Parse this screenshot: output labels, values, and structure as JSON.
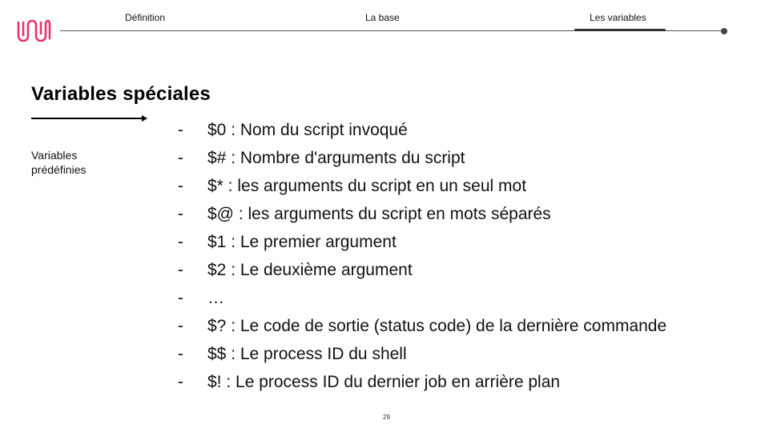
{
  "brand": {
    "logo_color": "#e8336d"
  },
  "nav": {
    "items": [
      {
        "label": "Définition",
        "active": false
      },
      {
        "label": "La base",
        "active": false
      },
      {
        "label": "Les variables",
        "active": true
      }
    ]
  },
  "slide": {
    "title": "Variables spéciales",
    "subtitle": "Variables prédéfinies",
    "bullet_marker": "-",
    "items": [
      "$0 : Nom du script invoqué",
      "$# : Nombre d'arguments du script",
      "$* : les arguments du script en un seul mot",
      "$@ : les arguments du script en mots séparés",
      "$1 : Le premier argument",
      "$2 : Le deuxième argument",
      "…",
      "$? : Le code de sortie (status code) de la dernière commande",
      "$$ : Le process ID du shell",
      "$! : Le process ID du dernier job en arrière plan"
    ],
    "page_number": "29"
  }
}
